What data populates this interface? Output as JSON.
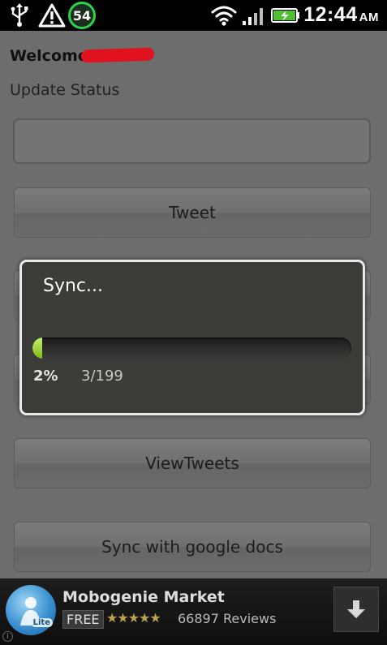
{
  "status_bar": {
    "time": "12:44",
    "ampm": "AM",
    "notification_count": "54",
    "icons": [
      "usb-icon",
      "warning-icon",
      "wifi-icon",
      "signal-icon",
      "battery-charging-icon"
    ]
  },
  "main": {
    "welcome_text": "Welcome",
    "update_status_label": "Update Status",
    "status_input_value": "",
    "buttons": {
      "tweet": "Tweet",
      "view_tweets": "ViewTweets",
      "sync_google_docs": "Sync with google docs"
    }
  },
  "dialog": {
    "title": "Sync...",
    "progress_fraction": 0.02,
    "percent_label": "2%",
    "count_label": "3/199"
  },
  "ad": {
    "app_name": "Mobogenie Market",
    "logo_label": "Lite",
    "price_badge": "FREE",
    "rating": 4.5,
    "stars_display": "★★★★★",
    "reviews": "66897 Reviews",
    "info_icon": "i"
  },
  "colors": {
    "accent_green": "#7dbb1b",
    "redaction_red": "#e0121d",
    "badge_green": "#2bd24a"
  }
}
